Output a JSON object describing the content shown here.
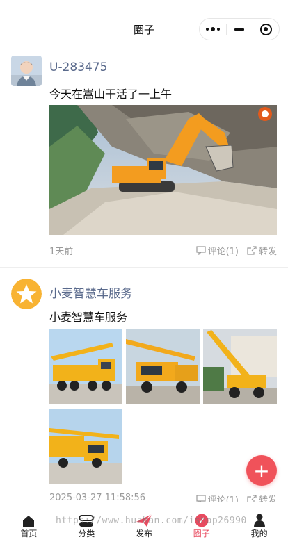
{
  "header": {
    "title": "圈子"
  },
  "posts": [
    {
      "author": "U-283475",
      "text": "今天在嵩山干活了一上午",
      "time": "1天前",
      "comment_label": "评论(1)",
      "share_label": "转发"
    },
    {
      "author": "小麦智慧车服务",
      "text": "小麦智慧车服务",
      "time": "2025-03-27 11:58:56",
      "comment_label": "评论(1)",
      "share_label": "转发"
    }
  ],
  "fab": {
    "label": "+"
  },
  "tabbar": {
    "items": [
      {
        "label": "首页",
        "icon": "home-icon"
      },
      {
        "label": "分类",
        "icon": "category-icon"
      },
      {
        "label": "发布",
        "icon": "publish-icon"
      },
      {
        "label": "圈子",
        "icon": "circle-icon"
      },
      {
        "label": "我的",
        "icon": "profile-icon"
      }
    ],
    "active_index": 3
  },
  "watermark": "https://www.huzhan.com/ishop26990",
  "colors": {
    "accent": "#e84a5f",
    "fab": "#f0525a",
    "author": "#5a6a8c",
    "excavator": "#f39c1f"
  }
}
